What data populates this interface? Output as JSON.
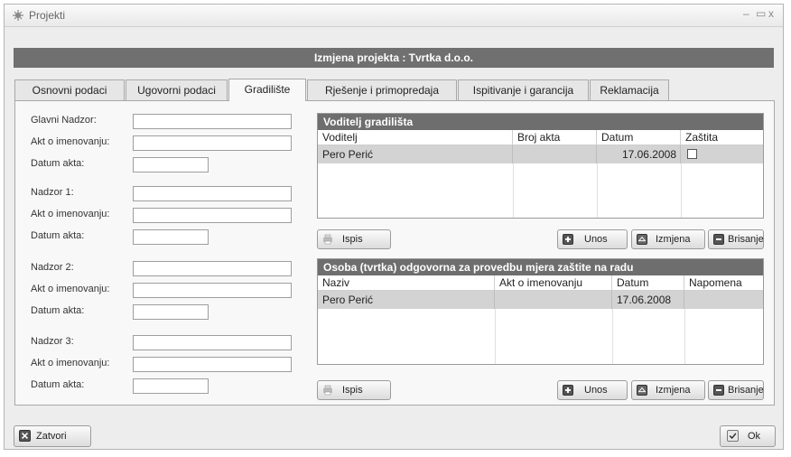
{
  "window": {
    "title": "Projekti",
    "minimize": "–",
    "maximize": "▭",
    "close": "x"
  },
  "header": {
    "title": "Izmjena projekta : Tvrtka d.o.o."
  },
  "tabs": [
    {
      "label": "Osnovni podaci"
    },
    {
      "label": "Ugovorni podaci"
    },
    {
      "label": "Gradilište"
    },
    {
      "label": "Rješenje i primopredaja"
    },
    {
      "label": "Ispitivanje i garancija"
    },
    {
      "label": "Reklamacija"
    }
  ],
  "active_tab": "Gradilište",
  "form": {
    "glavni_nadzor": "Glavni Nadzor:",
    "akt1": "Akt o imenovanju:",
    "datum1": "Datum akta:",
    "nadzor1": "Nadzor 1:",
    "akt2": "Akt o imenovanju:",
    "datum2": "Datum akta:",
    "nadzor2": "Nadzor 2:",
    "akt3": "Akt o imenovanju:",
    "datum3": "Datum akta:",
    "nadzor3": "Nadzor 3:",
    "akt4": "Akt o imenovanju:",
    "datum4": "Datum akta:"
  },
  "grid1": {
    "title": "Voditelj gradilišta",
    "columns": [
      "Voditelj",
      "Broj akta",
      "Datum",
      "Zaštita"
    ],
    "rows": [
      {
        "voditelj": "Pero Perić",
        "broj_akta": "",
        "datum": "17.06.2008",
        "zastita": false
      }
    ]
  },
  "grid2": {
    "title": "Osoba (tvrtka) odgovorna za provedbu mjera zaštite na radu",
    "columns": [
      "Naziv",
      "Akt o imenovanju",
      "Datum",
      "Napomena"
    ],
    "rows": [
      {
        "naziv": "Pero Perić",
        "akt": "",
        "datum": "17.06.2008",
        "napomena": ""
      }
    ]
  },
  "buttons": {
    "ispis": "Ispis",
    "unos": "Unos",
    "izmjena": "Izmjena",
    "brisanje": "Brisanje",
    "zatvori": "Zatvori",
    "ok": "Ok"
  }
}
